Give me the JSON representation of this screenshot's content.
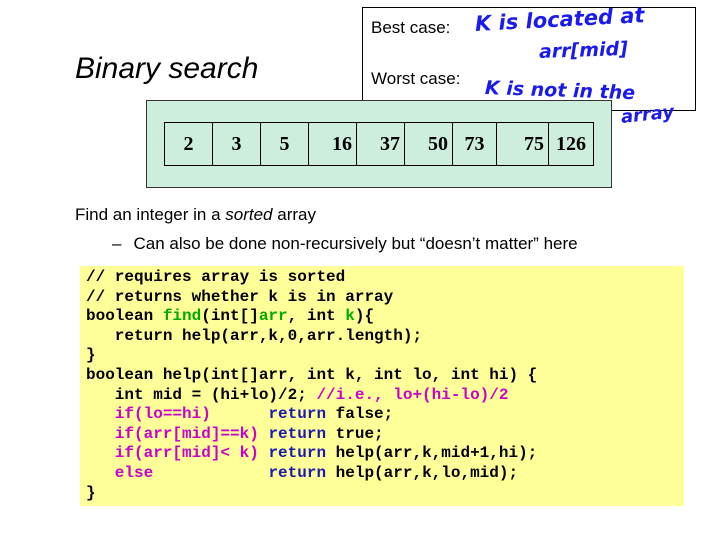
{
  "slide": {
    "title": "Binary search",
    "description_prefix": "Find an integer in a ",
    "description_emph": "sorted",
    "description_suffix": " array",
    "bullet": "Can also be done non-recursively but “doesn’t matter” here"
  },
  "array": {
    "values": [
      "2",
      "3",
      "5",
      "16",
      "37",
      "50",
      "73",
      "75",
      "126"
    ]
  },
  "notes": {
    "best_label": "Best case:",
    "best_line1": "K is located at",
    "best_line2": "arr[mid]",
    "worst_label": "Worst case:",
    "worst_line1": "K is not in the",
    "worst_line2": "array"
  },
  "code": {
    "l1": "// requires array is sorted",
    "l2": "// returns whether k is in array",
    "l3_kw": "boolean ",
    "l3_fn": "find",
    "l3_a": "(int[]",
    "l3_b": "arr",
    "l3_c": ", int ",
    "l3_d": "k",
    "l3_e": "){",
    "l4": "   return help(arr,k,0,arr.length);",
    "l5": "}",
    "l6": "boolean help(int[]arr, int k, int lo, int hi) {",
    "l7_a": "   int mid = (hi+lo)/2; ",
    "l7_cm": "//i.e., lo+(hi-lo)/2",
    "l8_if": "   if(lo==hi)      ",
    "l8_ret": "return",
    "l8_rest": " false;",
    "l9_if": "   if(arr[mid]==k) ",
    "l9_ret": "return",
    "l9_rest": " true;",
    "l10_if": "   if(arr[mid]< k) ",
    "l10_ret": "return",
    "l10_rest": " help(arr,k,mid+1,hi);",
    "l11_if": "   else            ",
    "l11_ret": "return",
    "l11_rest": " help(arr,k,lo,mid);",
    "l12": "}"
  },
  "colors": {
    "array_panel": "#cdeedd",
    "code_background": "#ffff99",
    "handwriting": "#1a1aee",
    "keyword": "#cc00cc",
    "function_name": "#00aa00"
  }
}
